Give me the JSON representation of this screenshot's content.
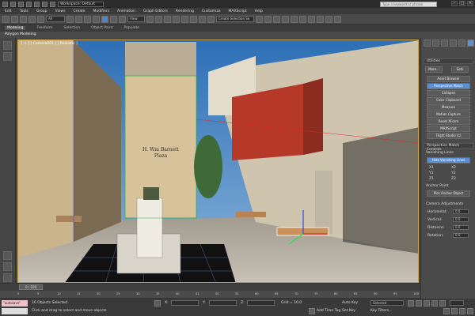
{
  "window": {
    "workspace": "Workspace: Default",
    "search_placeholder": "Type a keyword or phrase"
  },
  "menu": [
    "Edit",
    "Tools",
    "Group",
    "Views",
    "Create",
    "Modifiers",
    "Animation",
    "Graph Editors",
    "Rendering",
    "Customize",
    "MAXScript",
    "Help"
  ],
  "toolbar": {
    "selection_filter": "All",
    "ref_coord": "View",
    "named_selection": "Create Selection Se"
  },
  "ribbon": {
    "tabs": [
      "Modeling",
      "Freeform",
      "Selection",
      "Object Paint",
      "Populate"
    ],
    "active_tab": "Modeling",
    "subtitle": "Polygon Modeling"
  },
  "viewport": {
    "label": "[ + ] [ Camera001 ] [ Realistic ]",
    "sign_text": "H. Wm Barnett\nPlaza"
  },
  "utilities": {
    "title": "Utilities",
    "more": "More...",
    "sets": "Sets",
    "buttons": [
      "Asset Browser",
      "Perspective Match",
      "Collapse",
      "Color Clipboard",
      "Measure",
      "Motion Capture",
      "Reset XForm",
      "MAXScript",
      "Flight Studio (c)"
    ],
    "selected_button": "Perspective Match"
  },
  "perspective_match": {
    "title": "Perspective Match Controls",
    "vanishing_lines_label": "Vanishing Lines",
    "hide_lines_btn": "Hide Vanishing Lines",
    "axes": [
      "X1",
      "X2",
      "Y1",
      "Y2",
      "Z1",
      "Z2"
    ],
    "anchor_label": "Anchor Point",
    "pick_anchor_btn": "Pick Anchor Object",
    "camera_label": "Camera Adjustments",
    "fields": [
      {
        "label": "Horizontal:",
        "value": "0.0"
      },
      {
        "label": "Vertical:",
        "value": "0.0"
      },
      {
        "label": "Distance:",
        "value": "0.0"
      },
      {
        "label": "Rotation:",
        "value": "0.0"
      }
    ]
  },
  "timeline": {
    "slider": "0 / 100",
    "ticks": [
      "0",
      "5",
      "10",
      "15",
      "20",
      "25",
      "30",
      "35",
      "40",
      "45",
      "50",
      "55",
      "60",
      "65",
      "70",
      "75",
      "80",
      "85",
      "90",
      "95",
      "100"
    ]
  },
  "status": {
    "script_label": "\"autosave\"",
    "selected": "16 Objects Selected",
    "prompt": "Click and drag to select and move objects",
    "x_label": "X:",
    "y_label": "Y:",
    "z_label": "Z:",
    "grid": "Grid = 10.0",
    "auto_key": "Auto Key",
    "selected_dd": "Selected",
    "add_time_tag": "Add Time Tag",
    "set_key": "Set Key",
    "key_filters": "Key Filters..."
  }
}
